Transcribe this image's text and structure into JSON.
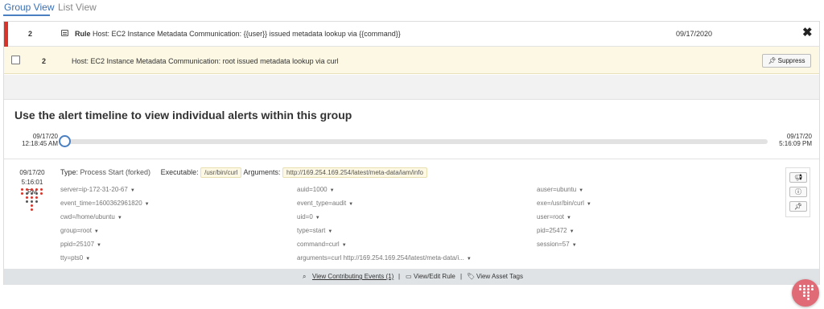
{
  "tabs": [
    {
      "label": "Group View",
      "active": true
    },
    {
      "label": "List View",
      "active": false
    }
  ],
  "rule_row": {
    "count": "2",
    "rule_label": "Rule",
    "rule_text": "Host: EC2 Instance Metadata Communication: {{user}} issued metadata lookup via {{command}}",
    "date": "09/17/2020",
    "close_glyph": "✖",
    "severity_color": "#d9342b"
  },
  "alert_row": {
    "count": "2",
    "text": "Host: EC2 Instance Metadata Communication: root issued metadata lookup via curl",
    "suppress_label": "Suppress",
    "background": "#fcf8e3"
  },
  "timeline": {
    "title": "Use the alert timeline to view individual alerts within this group",
    "start_date": "09/17/20",
    "start_time": "12:18:45 AM",
    "end_date": "09/17/20",
    "end_time": "5:16:09 PM",
    "position": 0
  },
  "event": {
    "date": "09/17/20",
    "time": "5:16:01 PM",
    "type_label": "Type:",
    "type_value": "Process Start (forked)",
    "executable_label": "Executable:",
    "executable_value": "/usr/bin/curl",
    "arguments_label": "Arguments:",
    "arguments_value": "http://169.254.169.254/latest/meta-data/iam/info",
    "fields_col1": [
      "server=ip-172-31-20-67",
      "event_time=1600362961820",
      "cwd=/home/ubuntu",
      "group=root",
      "ppid=25107",
      "tty=pts0"
    ],
    "fields_col2": [
      "auid=1000",
      "event_type=audit",
      "uid=0",
      "type=start",
      "command=curl",
      "arguments=curl http://169.254.169.254/latest/meta-data/i..."
    ],
    "fields_col3": [
      "auser=ubuntu",
      "exe=/usr/bin/curl",
      "user=root",
      "pid=25472",
      "session=57"
    ]
  },
  "footer": {
    "contributing_events": "View Contributing Events (1)",
    "edit_rule": "View/Edit Rule",
    "asset_tags": "View Asset Tags"
  },
  "icons": {
    "rule": "comment-icon",
    "suppress": "pin-icon",
    "side_top": "megaphone-icon",
    "side_mid": "info-icon",
    "side_bottom": "pin-icon",
    "footer_search": "search-icon",
    "footer_rule": "comment-icon",
    "footer_tags": "tag-icon"
  },
  "colors": {
    "accent": "#4a7fc1",
    "brand_fab": "#e06a75"
  }
}
